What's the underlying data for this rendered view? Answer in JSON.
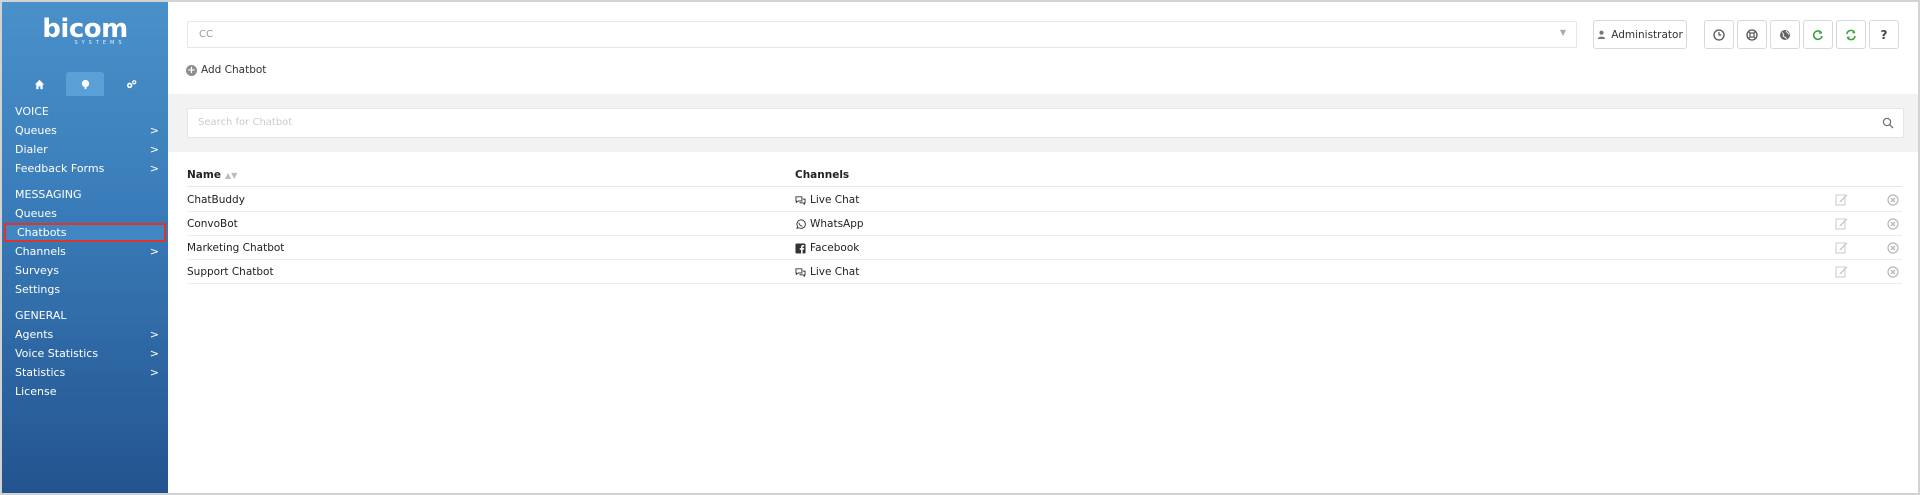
{
  "sidebar": {
    "logo": "bicom",
    "logo_sub": "SYSTEMS",
    "tabs": [
      {
        "icon": "home-icon"
      },
      {
        "icon": "brain-icon"
      },
      {
        "icon": "gears-icon"
      }
    ],
    "sections": [
      {
        "title": "VOICE",
        "items": [
          {
            "label": "Queues",
            "chevron": ">"
          },
          {
            "label": "Dialer",
            "chevron": ">"
          },
          {
            "label": "Feedback Forms",
            "chevron": ">"
          }
        ]
      },
      {
        "title": "MESSAGING",
        "items": [
          {
            "label": "Queues"
          },
          {
            "label": "Chatbots",
            "selected": true
          },
          {
            "label": "Channels",
            "chevron": ">"
          },
          {
            "label": "Surveys"
          },
          {
            "label": "Settings"
          }
        ]
      },
      {
        "title": "GENERAL",
        "items": [
          {
            "label": "Agents",
            "chevron": ">"
          },
          {
            "label": "Voice Statistics",
            "chevron": ">"
          },
          {
            "label": "Statistics",
            "chevron": ">"
          },
          {
            "label": "License"
          }
        ]
      }
    ]
  },
  "header": {
    "tenant_select": "CC",
    "user_button": "Administrator",
    "icon_buttons": [
      {
        "icon": "clock-icon"
      },
      {
        "icon": "lifebuoy-icon"
      },
      {
        "icon": "globe-icon"
      },
      {
        "icon": "reload-icon",
        "color": "#3aa33a"
      },
      {
        "icon": "sync-icon",
        "color": "#3aa33a"
      },
      {
        "icon": "help-icon",
        "label": "?"
      }
    ]
  },
  "actions": {
    "add_label": "Add Chatbot"
  },
  "search": {
    "placeholder": "Search for Chatbot"
  },
  "table": {
    "columns": {
      "name": "Name",
      "channels": "Channels"
    },
    "rows": [
      {
        "name": "ChatBuddy",
        "channel": "Live Chat",
        "channel_icon": "chat-bubbles-icon"
      },
      {
        "name": "ConvoBot",
        "channel": "WhatsApp",
        "channel_icon": "whatsapp-icon"
      },
      {
        "name": "Marketing Chatbot",
        "channel": "Facebook",
        "channel_icon": "facebook-icon"
      },
      {
        "name": "Support Chatbot",
        "channel": "Live Chat",
        "channel_icon": "chat-bubbles-icon"
      }
    ]
  },
  "colors": {
    "sidebar_top": "#4a90c9",
    "sidebar_bottom": "#23548f",
    "selected_border": "#e0342b",
    "green": "#3aa33a"
  }
}
